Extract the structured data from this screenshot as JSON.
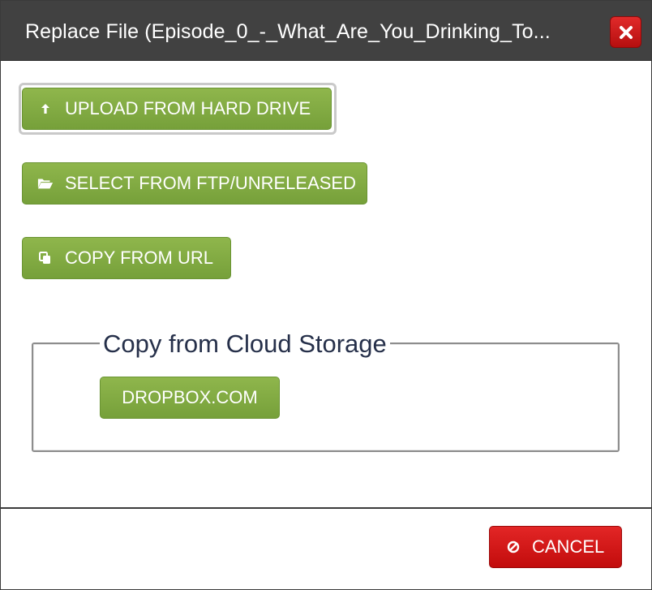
{
  "dialog": {
    "title": "Replace File (Episode_0_-_What_Are_You_Drinking_To...",
    "close_icon": "close-icon"
  },
  "buttons": {
    "upload": {
      "label": "UPLOAD FROM HARD DRIVE",
      "icon": "arrow-up-icon"
    },
    "ftp": {
      "label": "SELECT FROM FTP/UNRELEASED",
      "icon": "folder-open-icon"
    },
    "url": {
      "label": "COPY FROM URL",
      "icon": "copy-icon"
    }
  },
  "cloud_storage": {
    "legend": "Copy from Cloud Storage",
    "dropbox_label": "DROPBOX.COM"
  },
  "footer": {
    "cancel_label": "CANCEL",
    "cancel_icon": "ban-icon"
  },
  "colors": {
    "titlebar": "#414141",
    "green_button": "#82ad43",
    "red_button": "#d21a1a",
    "legend_text": "#26304a"
  }
}
